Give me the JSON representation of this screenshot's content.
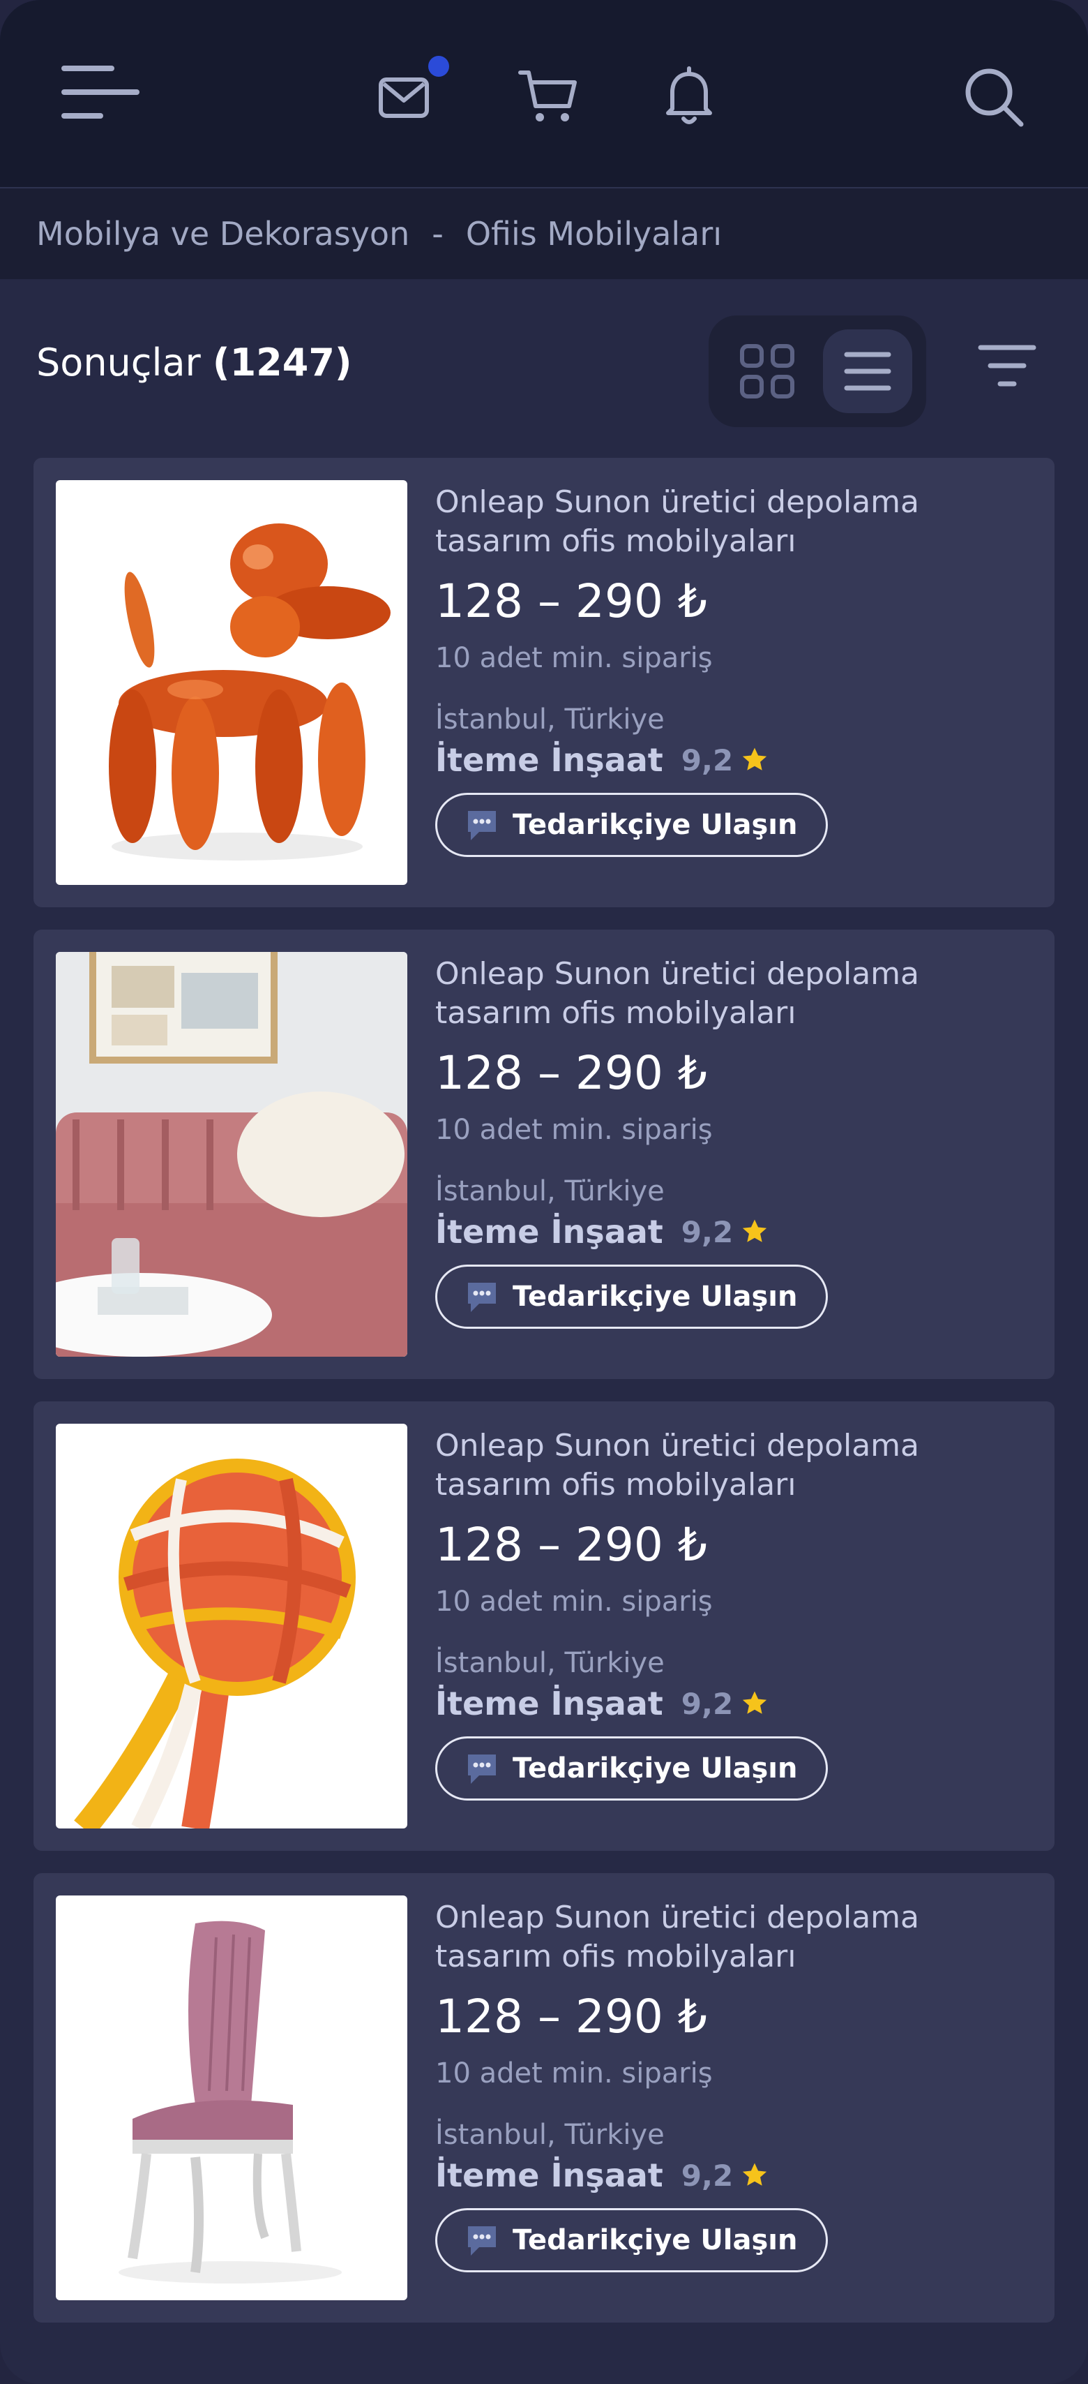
{
  "header": {
    "icons": [
      "menu-icon",
      "mail-icon",
      "cart-icon",
      "bell-icon",
      "search-icon"
    ],
    "mail_has_notification": true,
    "notification_color": "#2b4bd8"
  },
  "breadcrumb": {
    "items": [
      "Mobilya ve Dekorasyon",
      "Ofiis Mobilyaları"
    ],
    "separator": "-"
  },
  "results": {
    "label": "Sonuçlar",
    "count": "(1247)",
    "view_modes": [
      "grid-view-icon",
      "list-view-icon"
    ],
    "active_view": "list"
  },
  "products": [
    {
      "title": "Onleap Sunon üretici depolama tasarım ofis mobilyaları",
      "price": "128 – 290 ₺",
      "moq": "10 adet min. sipariş",
      "location": "İstanbul, Türkiye",
      "supplier": "İteme İnşaat",
      "rating": "9,2",
      "contact_label": "Tedarikçiye Ulaşın",
      "image": "orange-balloon-dog"
    },
    {
      "title": "Onleap Sunon üretici depolama tasarım ofis mobilyaları",
      "price": "128 – 290 ₺",
      "moq": "10 adet min. sipariş",
      "location": "İstanbul, Türkiye",
      "supplier": "İteme İnşaat",
      "rating": "9,2",
      "contact_label": "Tedarikçiye Ulaşın",
      "image": "pink-velvet-sofa"
    },
    {
      "title": "Onleap Sunon üretici depolama tasarım ofis mobilyaları",
      "price": "128 – 290 ₺",
      "moq": "10 adet min. sipariş",
      "location": "İstanbul, Türkiye",
      "supplier": "İteme İnşaat",
      "rating": "9,2",
      "contact_label": "Tedarikçiye Ulaşın",
      "image": "rope-knot-toy"
    },
    {
      "title": "Onleap Sunon üretici depolama tasarım ofis mobilyaları",
      "price": "128 – 290 ₺",
      "moq": "10 adet min. sipariş",
      "location": "İstanbul, Türkiye",
      "supplier": "İteme İnşaat",
      "rating": "9,2",
      "contact_label": "Tedarikçiye Ulaşın",
      "image": "pink-dining-chair"
    }
  ],
  "colors": {
    "background": "#262945",
    "card": "#363957",
    "topbar": "#161a2e",
    "star": "#f6c31b"
  }
}
